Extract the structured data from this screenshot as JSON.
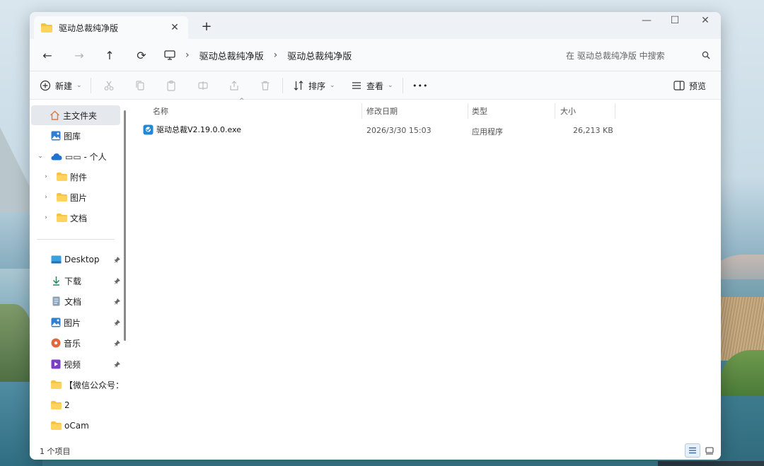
{
  "window": {
    "tab_title": "驱动总裁纯净版",
    "tab_close": "✕",
    "new_tab": "+",
    "controls": {
      "minimize": "—",
      "maximize": "☐",
      "close": "✕"
    }
  },
  "nav": {
    "back": "←",
    "forward": "→",
    "up": "↑",
    "refresh": "⟳",
    "separator": "›",
    "breadcrumbs": [
      "驱动总裁纯净版",
      "驱动总裁纯净版"
    ],
    "search_placeholder": "在 驱动总裁纯净版 中搜索"
  },
  "toolbar": {
    "new_label": "新建",
    "sort_label": "排序",
    "view_label": "查看",
    "more_label": "•••",
    "preview_label": "预览",
    "chevron": "⌄"
  },
  "sidebar": {
    "home": "主文件夹",
    "gallery": "图库",
    "onedrive": "▭▭ - 个人",
    "onedrive_children": [
      "附件",
      "图片",
      "文档"
    ],
    "quick_access": [
      {
        "label": "Desktop",
        "icon": "desktop-icon",
        "pinned": true
      },
      {
        "label": "下载",
        "icon": "download-icon",
        "pinned": true
      },
      {
        "label": "文档",
        "icon": "document-icon",
        "pinned": true
      },
      {
        "label": "图片",
        "icon": "pictures-icon",
        "pinned": true
      },
      {
        "label": "音乐",
        "icon": "music-icon",
        "pinned": true
      },
      {
        "label": "视频",
        "icon": "video-icon",
        "pinned": true
      },
      {
        "label": "【微信公众号：",
        "icon": "folder-icon",
        "pinned": false
      },
      {
        "label": "2",
        "icon": "folder-icon",
        "pinned": false
      },
      {
        "label": "oCam",
        "icon": "folder-icon",
        "pinned": false
      }
    ],
    "pin_glyph": "📌",
    "expander": "›",
    "expanded": "⌄"
  },
  "columns": {
    "name": "名称",
    "date": "修改日期",
    "type": "类型",
    "size": "大小",
    "sort_caret": "^"
  },
  "files": [
    {
      "name": "驱动总裁V2.19.0.0.exe",
      "date": "2026/3/30 15:03",
      "type": "应用程序",
      "size": "26,213 KB"
    }
  ],
  "status": {
    "count": "1 个项目"
  },
  "colors": {
    "folder": "#f5c242",
    "accent": "#0a64c8",
    "selected_bg": "#e5e9ee"
  }
}
